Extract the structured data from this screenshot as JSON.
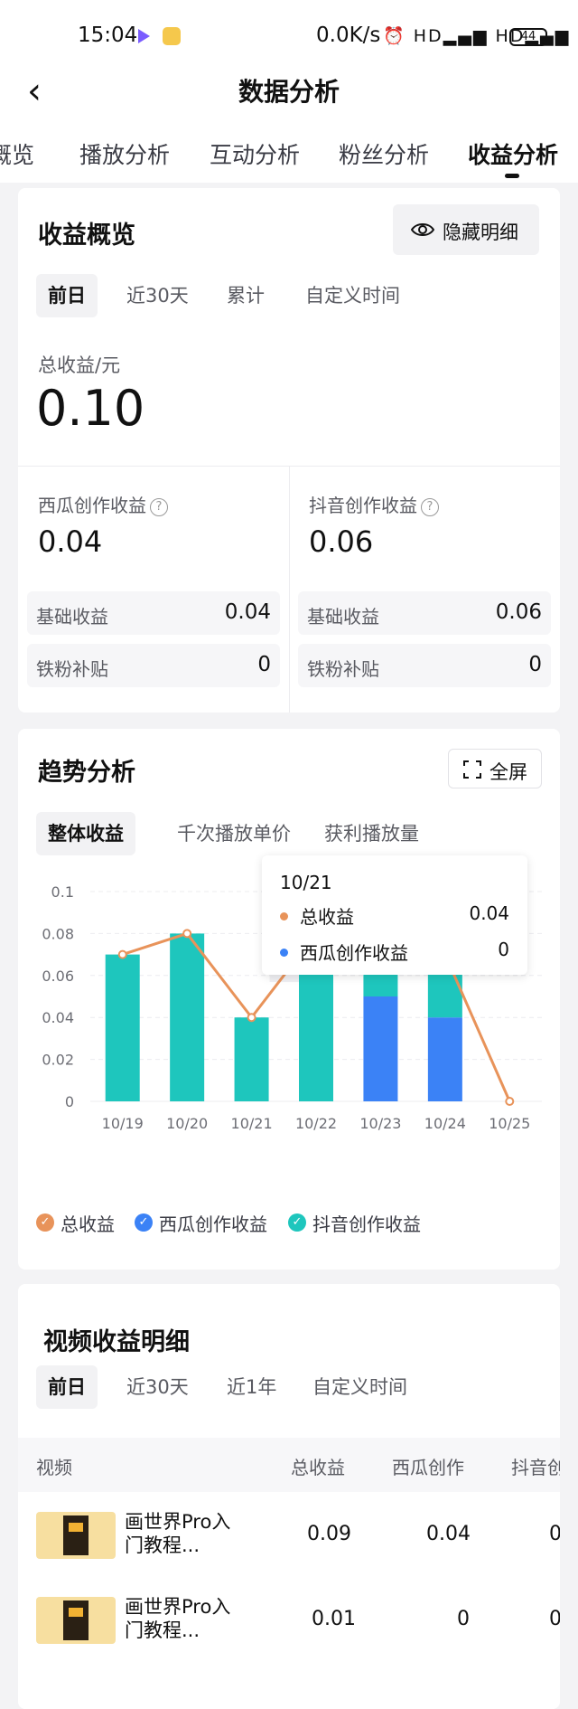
{
  "status_bar": {
    "time": "15:04",
    "network_speed": "0.0K/s",
    "icons_text": "⏰ HD▂▄▆ HD▂▄▆",
    "battery": "44"
  },
  "nav": {
    "title": "数据分析"
  },
  "tabs": [
    "概览",
    "播放分析",
    "互动分析",
    "粉丝分析",
    "收益分析"
  ],
  "overview": {
    "title": "收益概览",
    "hide_button": "隐藏明细",
    "periods": [
      "前日",
      "近30天",
      "累计",
      "自定义时间"
    ],
    "total_label": "总收益/元",
    "total_value": "0.10",
    "xigua": {
      "label": "西瓜创作收益",
      "value": "0.04",
      "base_label": "基础收益",
      "base_value": "0.04",
      "fan_label": "铁粉补贴",
      "fan_value": "0"
    },
    "douyin": {
      "label": "抖音创作收益",
      "value": "0.06",
      "base_label": "基础收益",
      "base_value": "0.06",
      "fan_label": "铁粉补贴",
      "fan_value": "0"
    }
  },
  "trend": {
    "title": "趋势分析",
    "fullscreen_button": "全屏",
    "subtabs": [
      "整体收益",
      "千次播放单价",
      "获利播放量"
    ],
    "tooltip": {
      "date": "10/21",
      "rows": [
        {
          "label": "总收益",
          "value": "0.04"
        },
        {
          "label": "西瓜创作收益",
          "value": "0"
        }
      ]
    },
    "legend": [
      "总收益",
      "西瓜创作收益",
      "抖音创作收益"
    ]
  },
  "chart_data": {
    "type": "bar",
    "categories": [
      "10/19",
      "10/20",
      "10/21",
      "10/22",
      "10/23",
      "10/24",
      "10/25"
    ],
    "series": [
      {
        "name": "西瓜创作收益",
        "values": [
          0,
          0,
          0,
          0,
          0.05,
          0.04,
          0
        ],
        "color": "#3b82f6"
      },
      {
        "name": "抖音创作收益",
        "values": [
          0.07,
          0.08,
          0.04,
          0.08,
          0.02,
          0.03,
          0
        ],
        "color": "#1ec6bd"
      },
      {
        "name": "总收益",
        "type": "line",
        "values": [
          0.07,
          0.08,
          0.04,
          0.08,
          0.07,
          0.07,
          0
        ],
        "color": "#e8935a"
      }
    ],
    "yticks": [
      "0.1",
      "0.08",
      "0.06",
      "0.04",
      "0.02",
      "0"
    ],
    "ylim": [
      0,
      0.1
    ],
    "grid": true,
    "legend_position": "bottom"
  },
  "detail": {
    "title": "视频收益明细",
    "periods": [
      "前日",
      "近30天",
      "近1年",
      "自定义时间"
    ],
    "columns": [
      "视频",
      "总收益",
      "西瓜创作",
      "抖音创"
    ],
    "rows": [
      {
        "title": "画世界Pro入门教程...",
        "total": "0.09",
        "xigua": "0.04",
        "douyin": "0"
      },
      {
        "title": "画世界Pro入门教程...",
        "total": "0.01",
        "xigua": "0",
        "douyin": "0"
      }
    ]
  },
  "colors": {
    "teal": "#1ec6bd",
    "blue": "#3b82f6",
    "orange": "#e8935a"
  }
}
